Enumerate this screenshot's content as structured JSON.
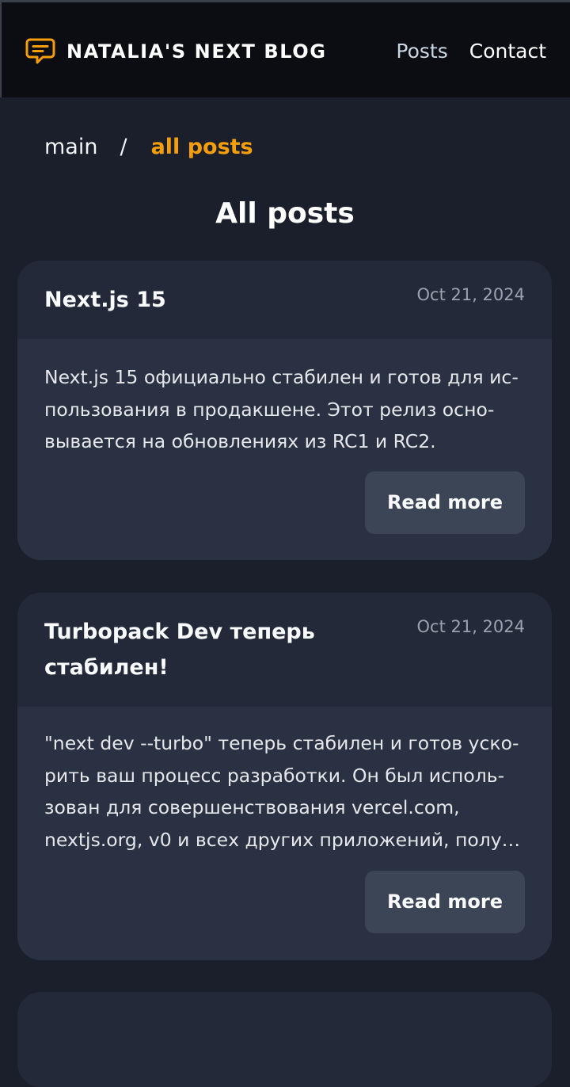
{
  "header": {
    "brand_icon": "chat-bubble-icon",
    "brand_title": "NATALIA'S NEXT BLOG",
    "nav": {
      "posts": "Posts",
      "contact": "Contact"
    }
  },
  "breadcrumb": {
    "main": "main",
    "separator": "/",
    "current": "all posts"
  },
  "page_title": "All posts",
  "posts": [
    {
      "title": "Next.js 15",
      "date": "Oct 21, 2024",
      "excerpt": "Next.js 15 официально стабилен и готов для ис­пользования в продакшене. Этот релиз осно­вывается на обновлениях из RC1 и RC2.",
      "read_more": "Read more"
    },
    {
      "title": "Turbopack Dev теперь стабилен!",
      "date": "Oct 21, 2024",
      "excerpt": "\"next dev --turbo\" теперь стабилен и готов уско­рить ваш процесс разработки. Он был исполь­зован для совершенствования vercel.com, nextjs.org, v0 и всех других приложений, полу…",
      "read_more": "Read more"
    }
  ],
  "colors": {
    "accent": "#f59e0b",
    "header_bg": "#0b0d13",
    "page_bg": "#1b1f2c",
    "card_bg": "#2a3142",
    "card_header_bg": "#232938",
    "button_bg": "#3b4556"
  }
}
